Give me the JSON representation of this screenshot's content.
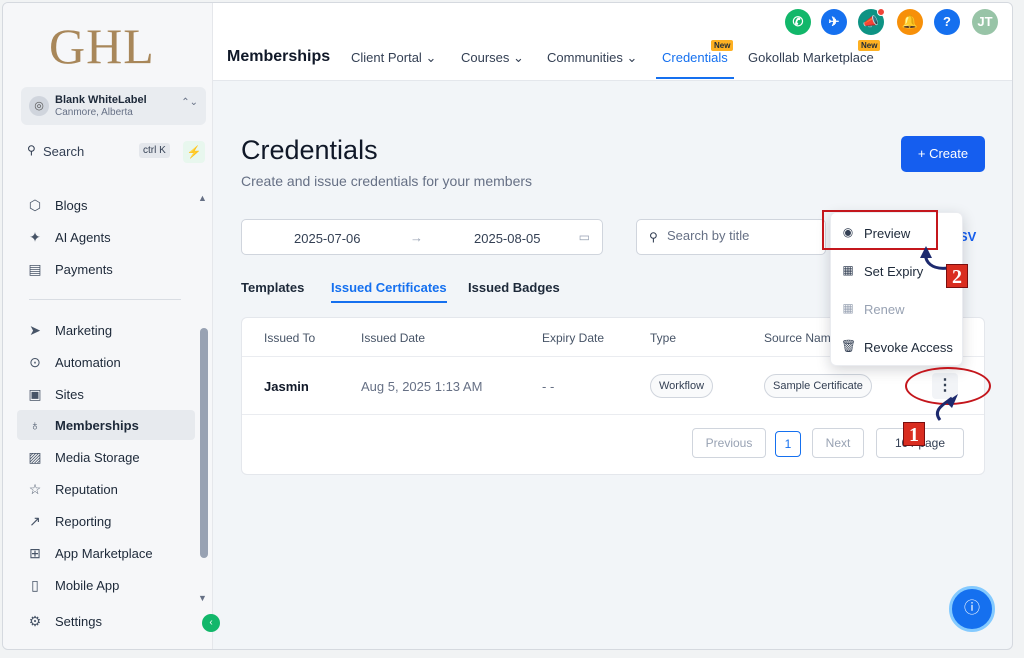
{
  "sidebar": {
    "logo": "GHL",
    "account": {
      "name": "Blank WhiteLabel",
      "location": "Canmore, Alberta"
    },
    "search": {
      "label": "Search",
      "shortcut": "ctrl K"
    },
    "items": [
      {
        "label": "Blogs",
        "icon": "cube-icon"
      },
      {
        "label": "AI Agents",
        "icon": "sparkle-icon"
      },
      {
        "label": "Payments",
        "icon": "invoice-icon"
      },
      {
        "label": "Marketing",
        "icon": "send-icon"
      },
      {
        "label": "Automation",
        "icon": "play-circle-icon"
      },
      {
        "label": "Sites",
        "icon": "browser-icon"
      },
      {
        "label": "Memberships",
        "icon": "award-icon"
      },
      {
        "label": "Media Storage",
        "icon": "image-icon"
      },
      {
        "label": "Reputation",
        "icon": "star-icon"
      },
      {
        "label": "Reporting",
        "icon": "trend-icon"
      },
      {
        "label": "App Marketplace",
        "icon": "grid-icon"
      },
      {
        "label": "Mobile App",
        "icon": "phone-icon"
      },
      {
        "label": "Settings",
        "icon": "gear-icon"
      }
    ]
  },
  "topbar": {
    "title": "Memberships",
    "tabs": [
      {
        "label": "Client Portal"
      },
      {
        "label": "Courses"
      },
      {
        "label": "Communities"
      },
      {
        "label": "Credentials"
      },
      {
        "label": "Gokollab Marketplace"
      }
    ],
    "new_badge": "New",
    "avatar_initials": "JT",
    "help_glyph": "?"
  },
  "colors": {
    "accent": "#155eef",
    "annotation": "#c4161c",
    "logo": "#a8875a"
  },
  "main": {
    "title": "Credentials",
    "subtitle": "Create and issue credentials for your members",
    "create_label": "Create",
    "date_from": "2025-07-06",
    "date_to": "2025-08-05",
    "search_placeholder": "Search by title",
    "export_fragment": "SV",
    "subtabs": [
      "Templates",
      "Issued Certificates",
      "Issued Badges"
    ]
  },
  "table": {
    "columns": [
      "Issued To",
      "Issued Date",
      "Expiry Date",
      "Type",
      "Source Name"
    ],
    "rows": [
      {
        "issued_to": "Jasmin",
        "issued_date": "Aug 5, 2025 1:13 AM",
        "expiry": "- -",
        "type": "Workflow",
        "source": "Sample Certificate"
      }
    ],
    "pagination": {
      "prev": "Previous",
      "page": "1",
      "next": "Next",
      "page_size": "10 / page"
    }
  },
  "menu": {
    "items": [
      {
        "label": "Preview",
        "icon": "eye-icon"
      },
      {
        "label": "Set Expiry",
        "icon": "calendar-icon"
      },
      {
        "label": "Renew",
        "icon": "calendar-icon"
      },
      {
        "label": "Revoke Access",
        "icon": "trash-icon"
      }
    ]
  },
  "annotations": {
    "step1": "1",
    "step2": "2"
  }
}
